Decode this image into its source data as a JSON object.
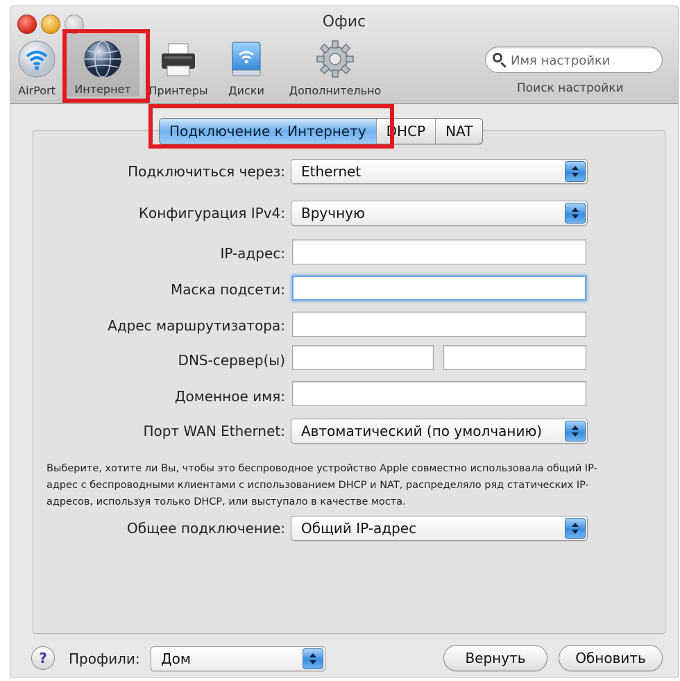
{
  "window": {
    "title": "Офис"
  },
  "toolbar": {
    "items": [
      {
        "label": "AirPort",
        "icon": "wifi-icon"
      },
      {
        "label": "Интернет",
        "icon": "globe-icon"
      },
      {
        "label": "Принтеры",
        "icon": "printer-icon"
      },
      {
        "label": "Диски",
        "icon": "disk-icon"
      },
      {
        "label": "Дополнительно",
        "icon": "gear-icon"
      }
    ],
    "search_placeholder": "Имя настройки",
    "search_caption": "Поиск настройки"
  },
  "tabs": [
    {
      "label": "Подключение к Интернету",
      "active": true
    },
    {
      "label": "DHCP",
      "active": false
    },
    {
      "label": "NAT",
      "active": false
    }
  ],
  "form": {
    "connect_via": {
      "label": "Подключиться через:",
      "value": "Ethernet"
    },
    "ipv4_config": {
      "label": "Конфигурация IPv4:",
      "value": "Вручную"
    },
    "ip_address": {
      "label": "IP-адрес:",
      "value": ""
    },
    "subnet_mask": {
      "label": "Маска подсети:",
      "value": ""
    },
    "router_address": {
      "label": "Адрес маршрутизатора:",
      "value": ""
    },
    "dns_servers": {
      "label": "DNS-сервер(ы)",
      "value1": "",
      "value2": ""
    },
    "domain_name": {
      "label": "Доменное имя:",
      "value": ""
    },
    "wan_port": {
      "label": "Порт WAN Ethernet:",
      "value": "Автоматический (по умолчанию)"
    },
    "description": "Выберите, хотите ли Вы, чтобы это беспроводное устройство Apple совместно использовала общий IP-адрес с беспроводными клиентами с использованием DHCP и NAT, распределяло ряд статических IP-адресов, используя только DHCP, или выступало в качестве моста.",
    "sharing": {
      "label": "Общее подключение:",
      "value": "Общий IP-адрес"
    }
  },
  "footer": {
    "help": "?",
    "profiles_label": "Профили:",
    "profile_value": "Дом",
    "revert_button": "Вернуть",
    "update_button": "Обновить"
  },
  "colors": {
    "highlight": "#e01b22",
    "active_tab": "#6fb1ee",
    "stepper": "#3a8ee0"
  }
}
